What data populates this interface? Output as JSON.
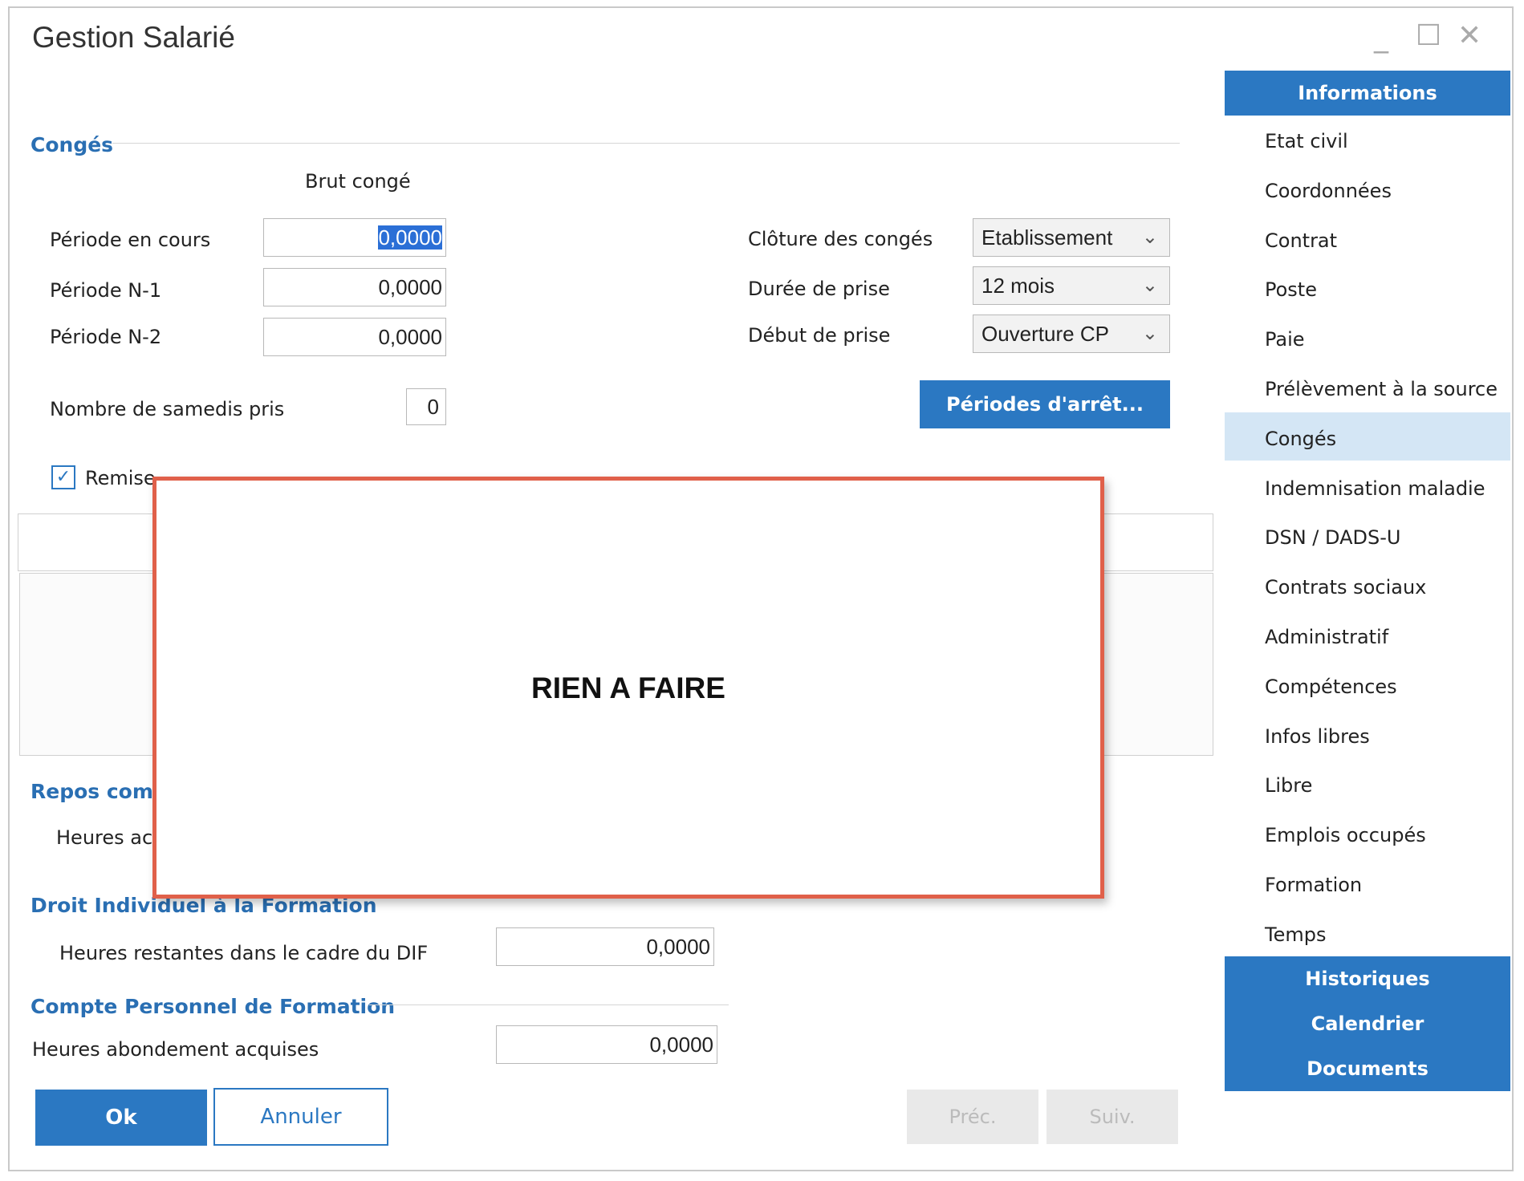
{
  "window": {
    "title": "Gestion Salarié",
    "controls": {
      "minimize": "_",
      "maximize": "☐",
      "close": "✕"
    }
  },
  "conges": {
    "section_title": "Congés",
    "column_header": "Brut congé",
    "periode_en_cours": {
      "label": "Période en cours",
      "value": "0,0000"
    },
    "periode_n1": {
      "label": "Période N-1",
      "value": "0,0000"
    },
    "periode_n2": {
      "label": "Période N-2",
      "value": "0,0000"
    },
    "samedis": {
      "label": "Nombre de samedis pris",
      "value": "0"
    },
    "cloture": {
      "label": "Clôture des congés",
      "value": "Etablissement"
    },
    "duree": {
      "label": "Durée de prise",
      "value": "12 mois"
    },
    "debut": {
      "label": "Début de prise",
      "value": "Ouverture CP"
    },
    "periodes_button": "Périodes d'arrêt...",
    "remise_checkbox": {
      "label": "Remise",
      "checked": true
    }
  },
  "repos": {
    "section_title": "Repos comp",
    "heures_label": "Heures ac"
  },
  "dif": {
    "section_title": "Droit Individuel à la Formation",
    "heures": {
      "label": "Heures restantes dans le cadre du DIF",
      "value": "0,0000"
    }
  },
  "cpf": {
    "section_title": "Compte Personnel de Formation",
    "heures": {
      "label": "Heures abondement acquises",
      "value": "0,0000"
    }
  },
  "buttons": {
    "ok": "Ok",
    "annuler": "Annuler",
    "prec": "Préc.",
    "suiv": "Suiv."
  },
  "overlay": {
    "text": "RIEN A FAIRE"
  },
  "sidebar": {
    "header": "Informations",
    "items": [
      "Etat civil",
      "Coordonnées",
      "Contrat",
      "Poste",
      "Paie",
      "Prélèvement à la source",
      "Congés",
      "Indemnisation maladie",
      "DSN / DADS-U",
      "Contrats sociaux",
      "Administratif",
      "Compétences",
      "Infos libres",
      "Libre",
      "Emplois occupés",
      "Formation",
      "Temps"
    ],
    "selected": "Congés",
    "footer": [
      "Historiques",
      "Calendrier",
      "Documents"
    ]
  },
  "colors": {
    "accent": "#2b78c2",
    "section": "#2a6fb3",
    "overlay_border": "#e0604a",
    "selected_bg": "#d4e6f5"
  }
}
